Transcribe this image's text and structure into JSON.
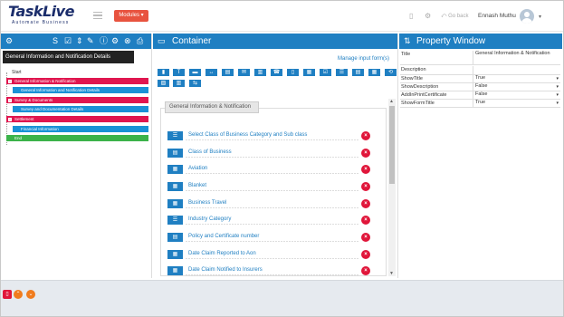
{
  "header": {
    "logo_main": "TaskLive",
    "logo_sub": "Automate Business",
    "modules_label": "Modules ▾",
    "go_back": "Go back",
    "user_name": "Ennash Muthu",
    "user_caret": "▾"
  },
  "left": {
    "tooltip": "General Information and Notification Details",
    "tree": {
      "start": "Start",
      "end": "End",
      "nodes": [
        {
          "label": "General Information & Notification",
          "kind": "pink",
          "icon": "−"
        },
        {
          "label": "General Information and Notification Details",
          "kind": "blue"
        },
        {
          "label": "Survey & Documents",
          "kind": "pink",
          "icon": "−"
        },
        {
          "label": "Survey and Documentation Details",
          "kind": "blue"
        },
        {
          "label": "Settlement",
          "kind": "pink",
          "icon": "−"
        },
        {
          "label": "Financial Information",
          "kind": "blue"
        }
      ]
    }
  },
  "center": {
    "title": "Container",
    "manage_link": "Manage input form(s)",
    "section_title": "General Information & Notification",
    "fields": [
      "Select Class of Business Category and Sub class",
      "Class of Business",
      "Aviation",
      "Blanket",
      "Business Travel",
      "Industry Category",
      "Policy and Certificate number",
      "Date Claim Reported to Aon",
      "Date Claim Notified to Insurers"
    ]
  },
  "right": {
    "title": "Property Window",
    "properties": [
      {
        "key": "Title",
        "value": "General Information & Notification",
        "dropdown": false
      },
      {
        "key": "Description",
        "value": "",
        "dropdown": false
      },
      {
        "key": "ShowTitle",
        "value": "True",
        "dropdown": true
      },
      {
        "key": "ShowDescription",
        "value": "False",
        "dropdown": true
      },
      {
        "key": "AddInPrintCertificate",
        "value": "False",
        "dropdown": true
      },
      {
        "key": "ShowFormTitle",
        "value": "True",
        "dropdown": true
      }
    ]
  },
  "colors": {
    "accent": "#1f7fc2",
    "danger": "#e0163a",
    "tree_pink": "#e0164f",
    "tree_blue": "#1a91d6",
    "tree_green": "#3bb34a",
    "modules": "#e8533f",
    "footer_orange": "#f07c1e"
  }
}
